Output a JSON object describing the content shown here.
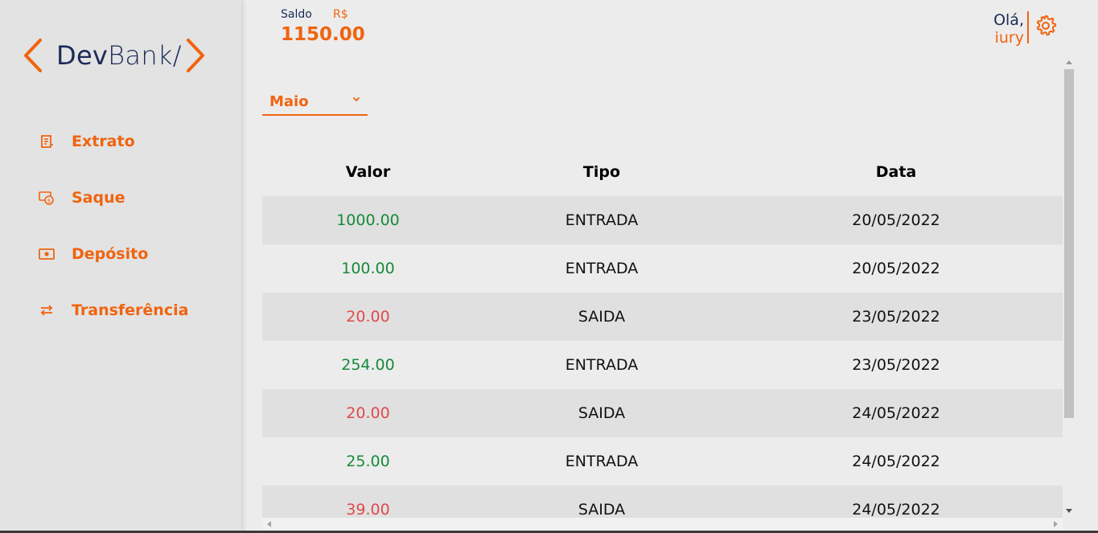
{
  "brand": {
    "dev": "Dev",
    "bank": "Bank/",
    "accent": "#f0640f",
    "navy": "#1b2b57"
  },
  "sidebar": {
    "items": [
      {
        "label": "Extrato",
        "icon": "receipt-icon"
      },
      {
        "label": "Saque",
        "icon": "cash-withdraw-icon"
      },
      {
        "label": "Depósito",
        "icon": "deposit-icon"
      },
      {
        "label": "Transferência",
        "icon": "transfer-arrows-icon"
      }
    ]
  },
  "header": {
    "saldo_label": "Saldo",
    "currency": "R$",
    "balance": "1150.00",
    "greeting": "Olá,",
    "user": "iury"
  },
  "filter": {
    "month": "Maio"
  },
  "table": {
    "headers": [
      "Valor",
      "Tipo",
      "Data"
    ],
    "rows": [
      {
        "valor": "1000.00",
        "tipo": "ENTRADA",
        "data": "20/05/2022"
      },
      {
        "valor": "100.00",
        "tipo": "ENTRADA",
        "data": "20/05/2022"
      },
      {
        "valor": "20.00",
        "tipo": "SAIDA",
        "data": "23/05/2022"
      },
      {
        "valor": "254.00",
        "tipo": "ENTRADA",
        "data": "23/05/2022"
      },
      {
        "valor": "20.00",
        "tipo": "SAIDA",
        "data": "24/05/2022"
      },
      {
        "valor": "25.00",
        "tipo": "ENTRADA",
        "data": "24/05/2022"
      },
      {
        "valor": "39.00",
        "tipo": "SAIDA",
        "data": "24/05/2022"
      }
    ]
  },
  "colors": {
    "entrada": "#178a3a",
    "saida": "#e0494c"
  }
}
